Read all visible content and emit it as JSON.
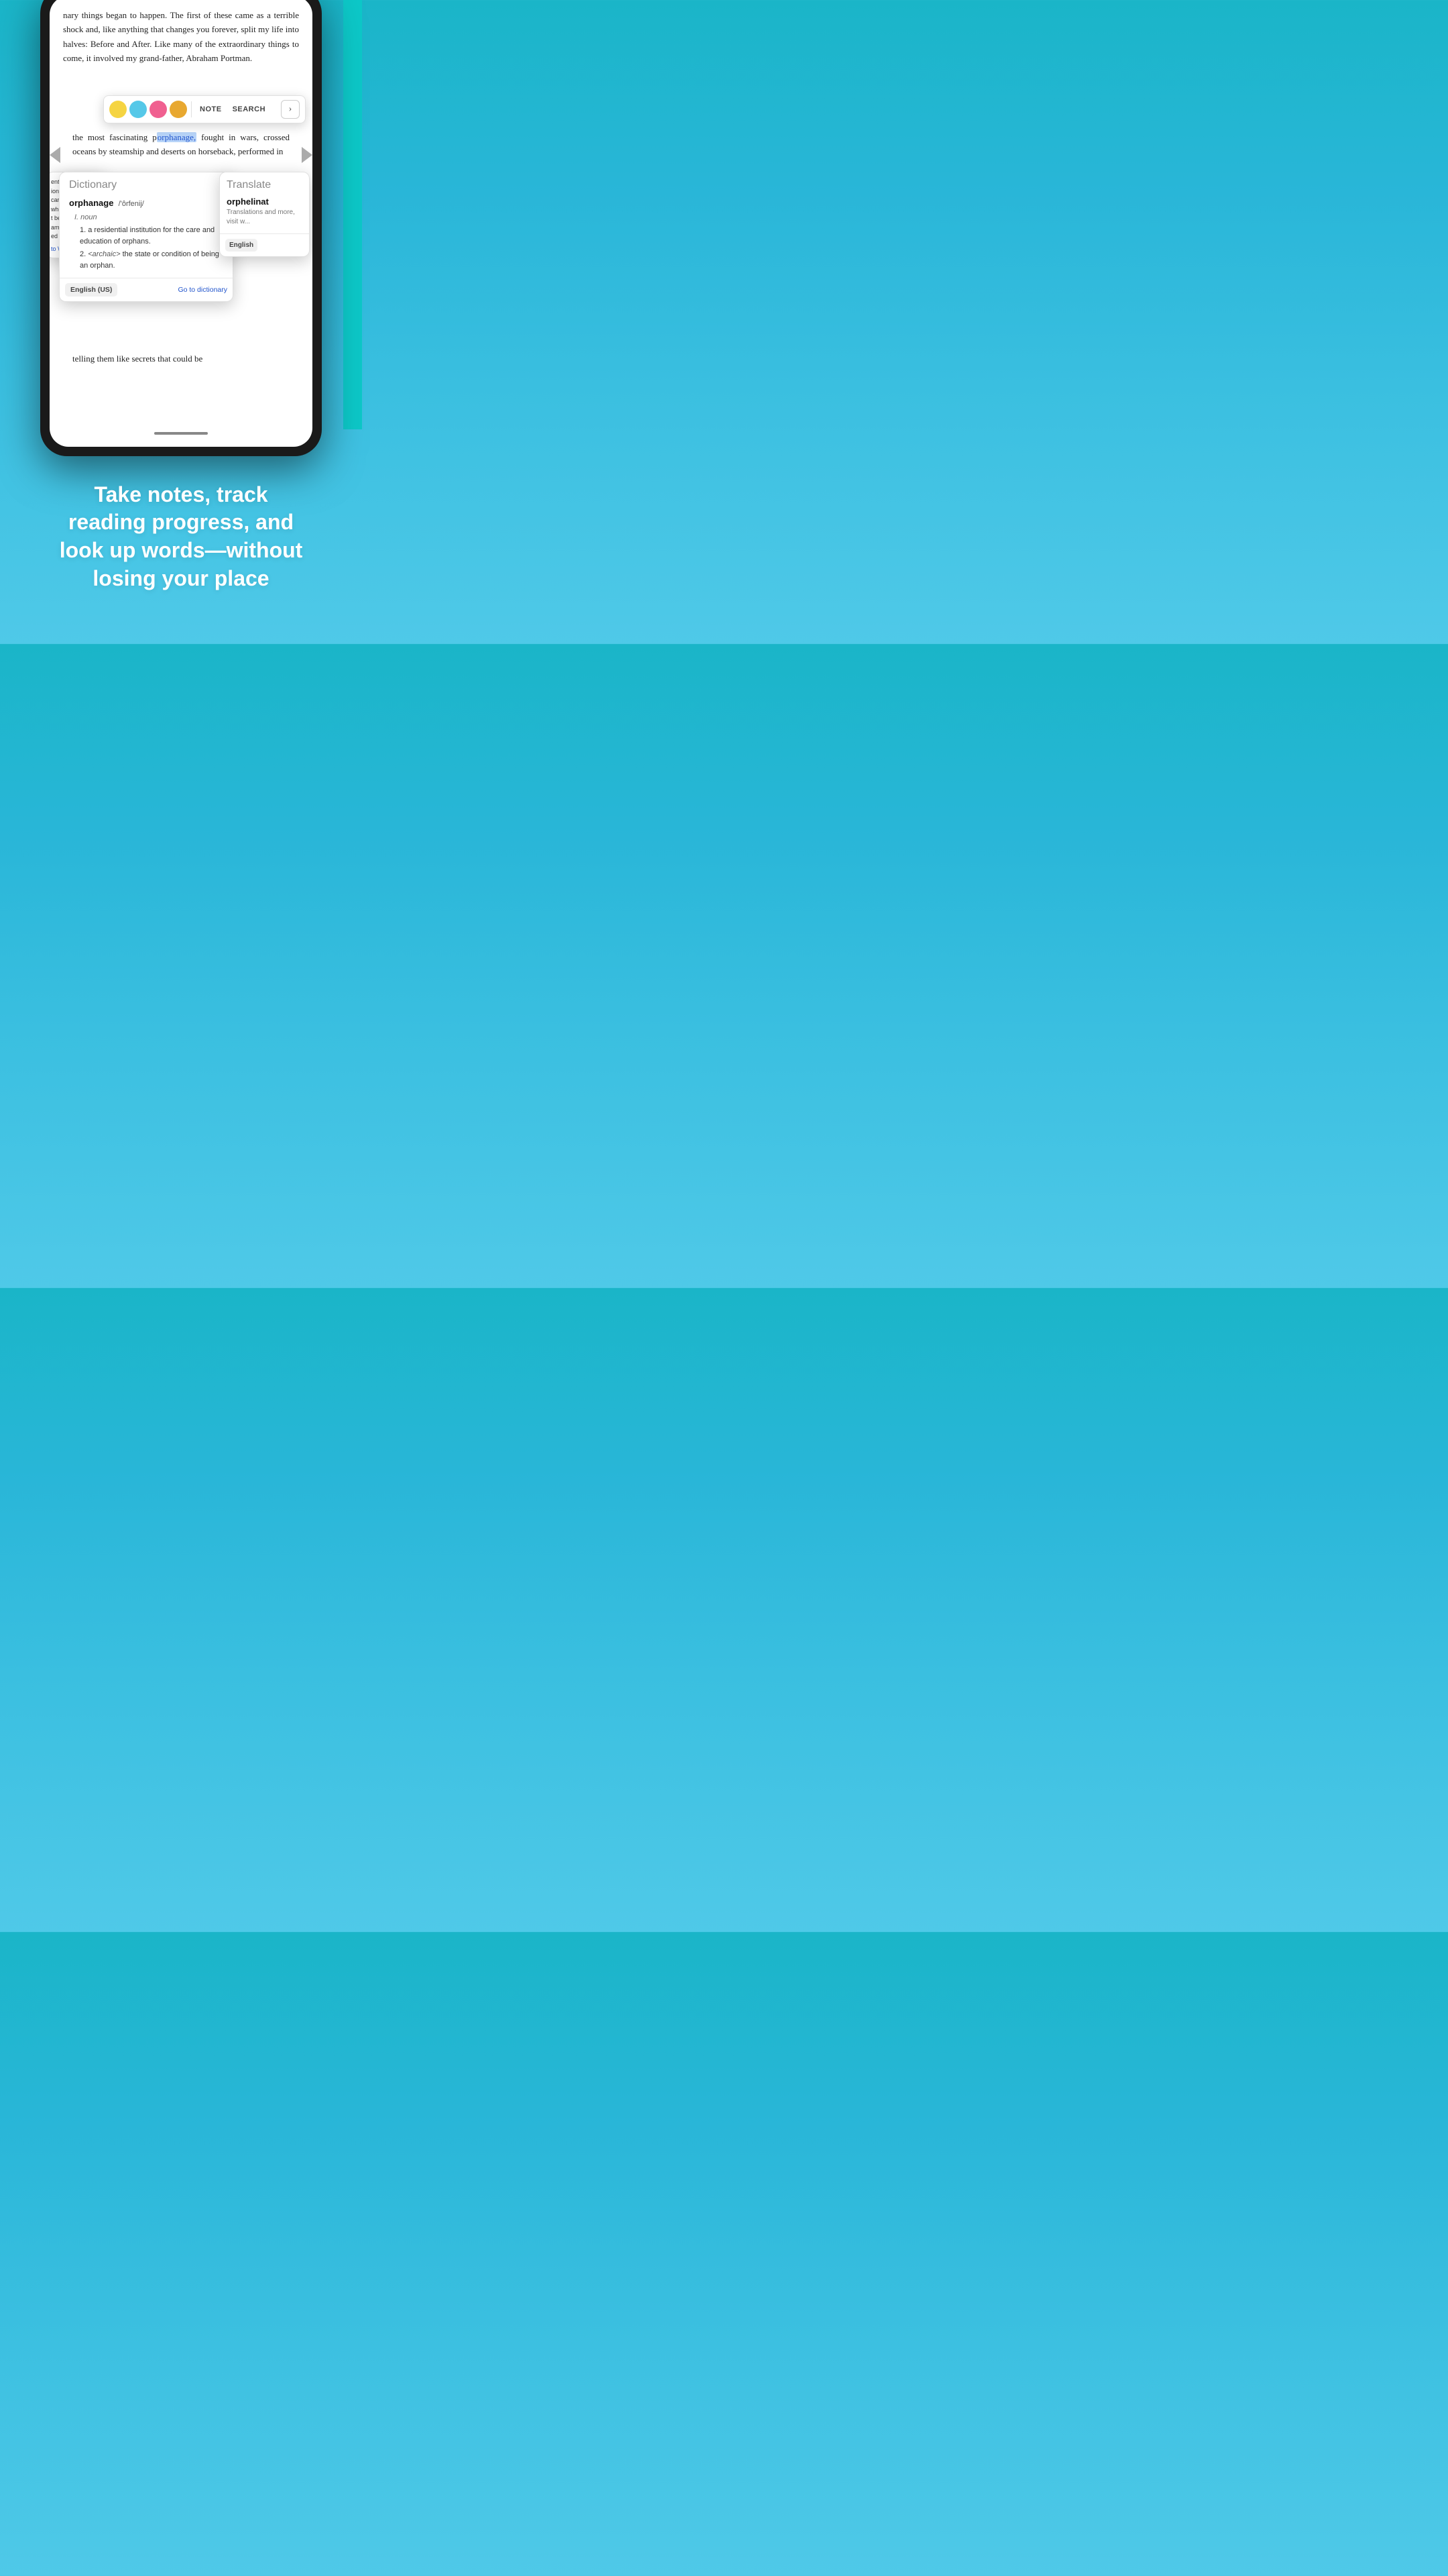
{
  "background": {
    "gradient_start": "#1ab5c8",
    "gradient_end": "#4fc9e8"
  },
  "phone": {
    "book_text_top": "nary things began to happen. The first of these came as a terrible shock and, like anything that changes you forever, split my life into halves: Before and After. Like many of the extraordinary things to come, it involved my grand-father, Abraham Portman.",
    "book_text_middle_before": "the most fascinating p",
    "book_text_middle_highlight": "orphanage,",
    "book_text_middle_after": " fought in wars, crossed oceans by steamship and deserts on horseback, performed in",
    "book_text_bottom": "telling them like secrets that could be"
  },
  "toolbar": {
    "colors": [
      {
        "name": "yellow",
        "hex": "#f5d442"
      },
      {
        "name": "blue",
        "hex": "#56c8e8"
      },
      {
        "name": "pink",
        "hex": "#f06090"
      },
      {
        "name": "gold",
        "hex": "#e8a830"
      }
    ],
    "note_label": "NOTE",
    "search_label": "SEARCH"
  },
  "dictionary": {
    "header": "Dictionary",
    "word": "orphanage",
    "phonetic": "/'ôrfenij/",
    "pos": "noun",
    "definition1": "a residential institution for the care and education of orphans.",
    "definition2": "<archaic> the state or condition of being an orphan.",
    "footer_lang": "English (US)",
    "footer_link": "Go to dictionary"
  },
  "translate": {
    "header": "Translate",
    "word": "orphelinat",
    "sub_text": "Translations and more, visit w...",
    "footer_lang": "English"
  },
  "wikipedia": {
    "text_lines": [
      "ential",
      "ion or group",
      "care of",
      "who, for",
      "t be cared",
      "amilies. The",
      "ed"
    ],
    "link": "to Wikipedia"
  },
  "tagline": {
    "line1": "Take notes, track",
    "line2": "reading progress, and",
    "line3": "look up words—without",
    "line4": "losing your place"
  }
}
